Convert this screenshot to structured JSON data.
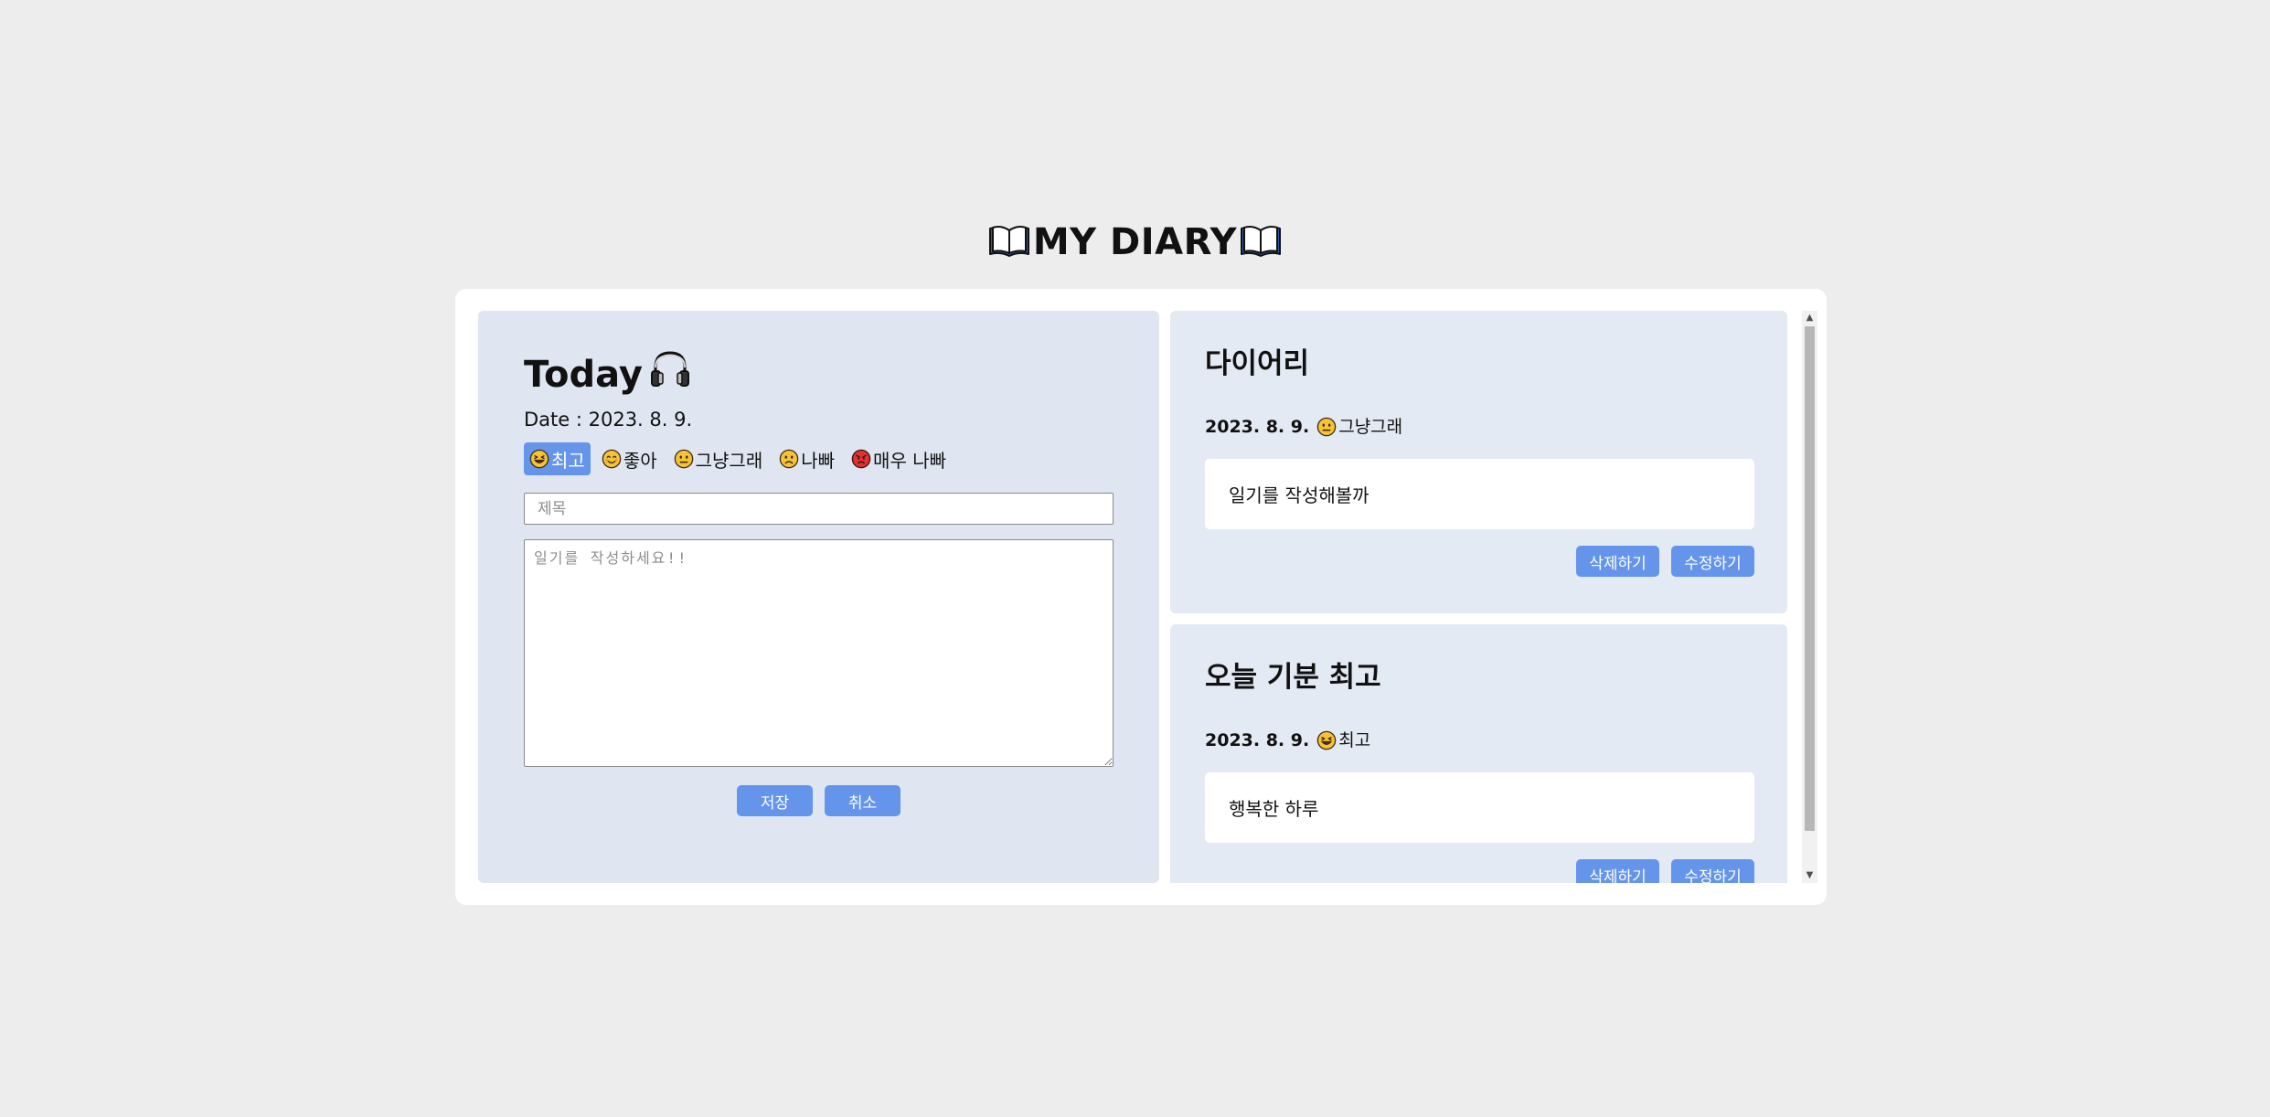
{
  "header": {
    "title": "MY DIARY",
    "left_icon": "open-book-icon",
    "right_icon": "open-book-icon"
  },
  "editor": {
    "heading": "Today",
    "heading_icon": "headphones-icon",
    "date_line": "Date : 2023. 8. 9.",
    "moods": [
      {
        "label": "최고",
        "icon": "grinning-squinting-face-icon",
        "selected": true
      },
      {
        "label": "좋아",
        "icon": "smiling-face-icon",
        "selected": false
      },
      {
        "label": "그냥그래",
        "icon": "neutral-face-icon",
        "selected": false
      },
      {
        "label": "나빠",
        "icon": "frowning-face-icon",
        "selected": false
      },
      {
        "label": "매우 나빠",
        "icon": "angry-face-icon",
        "selected": false
      }
    ],
    "title_placeholder": "제목",
    "title_value": "",
    "content_placeholder": "일기를 작성하세요!!",
    "content_value": "",
    "save_label": "저장",
    "cancel_label": "취소"
  },
  "entries": [
    {
      "title": "다이어리",
      "date": "2023. 8. 9.",
      "mood_label": "그냥그래",
      "mood_icon": "neutral-face-icon",
      "body": "일기를 작성해볼까",
      "delete_label": "삭제하기",
      "edit_label": "수정하기"
    },
    {
      "title": "오늘 기분 최고",
      "date": "2023. 8. 9.",
      "mood_label": "최고",
      "mood_icon": "grinning-squinting-face-icon",
      "body": "행복한 하루",
      "delete_label": "삭제하기",
      "edit_label": "수정하기"
    }
  ],
  "colors": {
    "background": "#ededed",
    "card": "#ffffff",
    "editor_panel": "#dfe6f1",
    "entry_panel": "#e4eaf3",
    "accent": "#6595ea",
    "emoji_yellow": "#f5c238",
    "emoji_red": "#e0322f"
  }
}
